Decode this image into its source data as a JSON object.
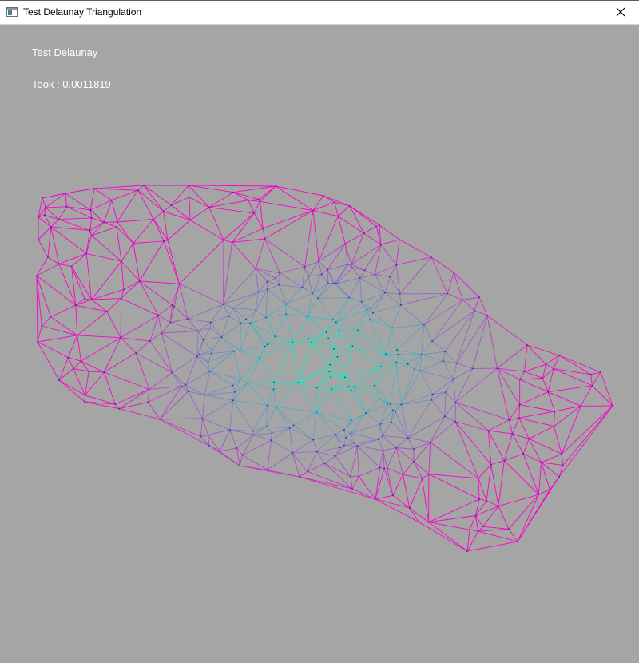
{
  "window": {
    "title": "Test Delaunay Triangulation",
    "icon": "app-window-icon",
    "close_icon": "close-icon"
  },
  "canvas": {
    "background": "#a5a5a5",
    "heading": "Test Delaunay",
    "timing": "Took : 0.0011819"
  },
  "mesh": {
    "edge_color_outer": "#ff00cc",
    "edge_color_inner": "#00ffc0",
    "point_color": "#1b3b8f"
  }
}
